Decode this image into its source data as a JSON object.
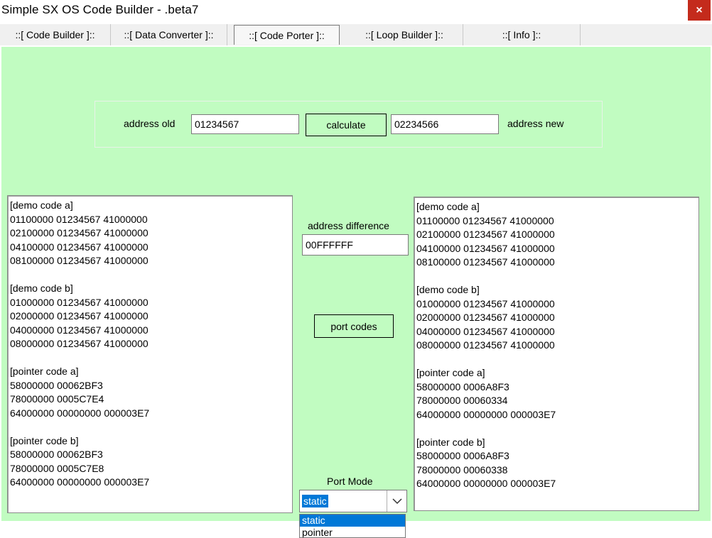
{
  "window": {
    "title": "Simple SX OS Code Builder - .beta7",
    "close_glyph": "×"
  },
  "tabs": [
    {
      "label": "::[ Code Builder ]::"
    },
    {
      "label": "::[ Data Converter ]::"
    },
    {
      "label": "::[ Code Porter ]::",
      "active": true
    },
    {
      "label": "::[ Loop Builder ]::"
    },
    {
      "label": "::[ Info ]::"
    }
  ],
  "porter": {
    "address_old_label": "address old",
    "address_old_value": "01234567",
    "calculate_label": "calculate",
    "address_new_value": "02234566",
    "address_new_label": "address new",
    "difference_label": "address difference",
    "difference_value": "00FFFFFF",
    "port_button_label": "port codes",
    "port_mode_label": "Port Mode",
    "port_mode_value": "static",
    "port_mode_options": [
      "static",
      "pointer"
    ]
  },
  "input_code": [
    "[demo code a]",
    "01100000 01234567 41000000",
    "02100000 01234567 41000000",
    "04100000 01234567 41000000",
    "08100000 01234567 41000000",
    "",
    "[demo code b]",
    "01000000 01234567 41000000",
    "02000000 01234567 41000000",
    "04000000 01234567 41000000",
    "08000000 01234567 41000000",
    "",
    "[pointer code a]",
    "58000000 00062BF3",
    "78000000 0005C7E4",
    "64000000 00000000 000003E7",
    "",
    "[pointer code b]",
    "58000000 00062BF3",
    "78000000 0005C7E8",
    "64000000 00000000 000003E7"
  ],
  "output_code": [
    "[demo code a]",
    "01100000 01234567 41000000",
    "02100000 01234567 41000000",
    "04100000 01234567 41000000",
    "08100000 01234567 41000000",
    "",
    "[demo code b]",
    "01000000 01234567 41000000",
    "02000000 01234567 41000000",
    "04000000 01234567 41000000",
    "08000000 01234567 41000000",
    "",
    "[pointer code a]",
    "58000000 0006A8F3",
    "78000000 00060334",
    "64000000 00000000 000003E7",
    "",
    "[pointer code b]",
    "58000000 0006A8F3",
    "78000000 00060338",
    "64000000 00000000 000003E7"
  ],
  "colors": {
    "pane_bg": "#c1fcc1",
    "selection": "#0078d7",
    "close_bg": "#c42b1c"
  },
  "icons": {
    "close": "close-icon",
    "dropdown": "chevron-down-icon"
  }
}
